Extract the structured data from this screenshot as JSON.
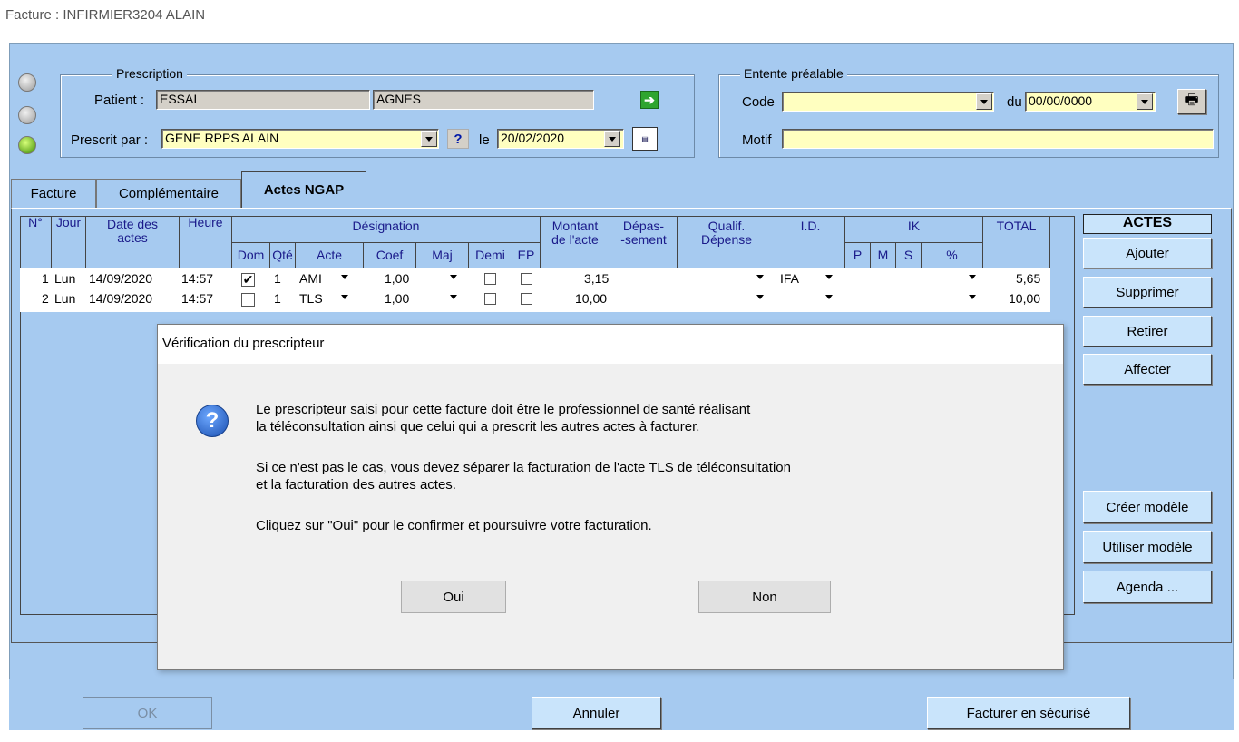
{
  "window": {
    "title": "Facture : INFIRMIER3204 ALAIN"
  },
  "prescription": {
    "group_label": "Prescription",
    "patient_label": "Patient :",
    "patient_lastname": "ESSAI",
    "patient_firstname": "AGNES",
    "prescrit_par_label": "Prescrit par :",
    "prescrit_par_value": "GENE RPPS ALAIN",
    "help_button": "?",
    "le_label": "le",
    "date_value": "20/02/2020"
  },
  "entente": {
    "group_label": "Entente préalable",
    "code_label": "Code",
    "code_value": "",
    "du_label": "du",
    "du_value": "00/00/0000",
    "motif_label": "Motif",
    "motif_value": ""
  },
  "tabs": [
    {
      "label": "Facture"
    },
    {
      "label": "Complémentaire"
    },
    {
      "label": "Actes NGAP"
    }
  ],
  "grid": {
    "headers": {
      "num": "N°",
      "jour": "Jour",
      "date": "Date des actes",
      "heure": "Heure",
      "designation": "Désignation",
      "dom": "Dom",
      "qte": "Qté",
      "acte": "Acte",
      "coef": "Coef",
      "maj": "Maj",
      "demi": "Demi",
      "ep": "EP",
      "montant": "Montant de l'acte",
      "depassement": "Dépas- -sement",
      "qualif": "Qualif. Dépense",
      "id": "I.D.",
      "ik": "IK",
      "ik_p": "P",
      "ik_m": "M",
      "ik_s": "S",
      "ik_pct": "%",
      "total": "TOTAL"
    },
    "rows": [
      {
        "num": "1",
        "jour": "Lun",
        "date": "14/09/2020",
        "heure": "14:57",
        "dom": "✔",
        "qte": "1",
        "acte": "AMI",
        "coef": "1,00",
        "montant": "3,15",
        "id": "IFA",
        "total": "5,65"
      },
      {
        "num": "2",
        "jour": "Lun",
        "date": "14/09/2020",
        "heure": "14:57",
        "dom": "",
        "qte": "1",
        "acte": "TLS",
        "coef": "1,00",
        "montant": "10,00",
        "id": "",
        "total": "10,00"
      }
    ]
  },
  "actes_panel": {
    "title": "ACTES",
    "buttons": [
      "Ajouter",
      "Supprimer",
      "Retirer",
      "Affecter"
    ],
    "model_buttons": [
      "Créer modèle",
      "Utiliser modèle",
      "Agenda ..."
    ]
  },
  "dialog": {
    "title": "Vérification du prescripteur",
    "para1_line1": "Le prescripteur saisi pour cette facture doit être le professionnel de santé réalisant",
    "para1_line2": "la téléconsultation ainsi que celui qui a prescrit les autres actes à facturer.",
    "para2_line1": "Si ce n'est pas le cas, vous devez séparer la facturation de l'acte TLS de téléconsultation",
    "para2_line2": "et la facturation des autres actes.",
    "para3": "Cliquez sur \"Oui\" pour le confirmer et poursuivre votre facturation.",
    "yes": "Oui",
    "no": "Non"
  },
  "footer": {
    "ok": "OK",
    "cancel": "Annuler",
    "secure": "Facturer en sécurisé"
  },
  "colors": {
    "panel": "#a6caf0",
    "yellow_field": "#ffffc0",
    "button": "#c9e4fb"
  }
}
